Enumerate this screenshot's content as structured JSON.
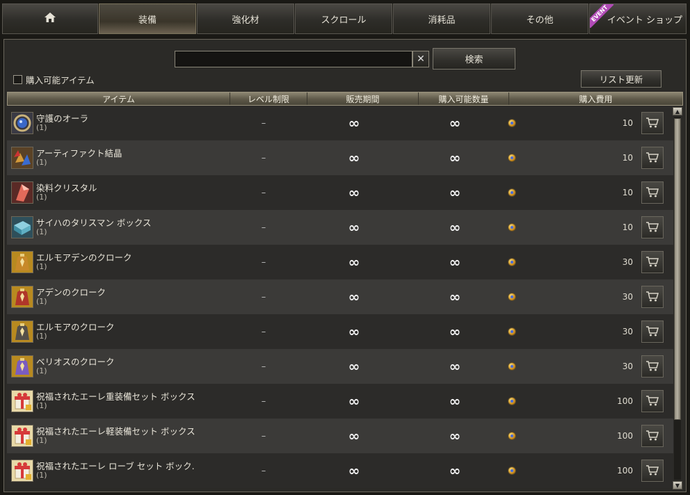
{
  "tabs": [
    {
      "label": "",
      "icon": "home-icon",
      "active": false
    },
    {
      "label": "装備",
      "active": true
    },
    {
      "label": "強化材",
      "active": false
    },
    {
      "label": "スクロール",
      "active": false
    },
    {
      "label": "消耗品",
      "active": false
    },
    {
      "label": "その他",
      "active": false
    },
    {
      "label": "イベント ショップ",
      "badge": "EVENT",
      "active": false
    }
  ],
  "search": {
    "value": "",
    "placeholder": "",
    "clear_label": "✕",
    "button_label": "検索"
  },
  "filter": {
    "buyable_label": "購入可能アイテム",
    "checked": false
  },
  "refresh_label": "リスト更新",
  "table": {
    "headers": [
      "アイテム",
      "レベル制限",
      "販売期間",
      "購入可能数量",
      "購入費用"
    ],
    "rows": [
      {
        "name": "守護のオーラ",
        "count": "(1)",
        "level": "–",
        "period": "∞",
        "qty": "∞",
        "price": "10",
        "icon": "aura-icon"
      },
      {
        "name": "アーティファクト結晶",
        "count": "(1)",
        "level": "–",
        "period": "∞",
        "qty": "∞",
        "price": "10",
        "icon": "crystal-icon"
      },
      {
        "name": "染料クリスタル",
        "count": "(1)",
        "level": "–",
        "period": "∞",
        "qty": "∞",
        "price": "10",
        "icon": "dye-crystal-icon"
      },
      {
        "name": "サイハのタリスマン ボックス",
        "count": "(1)",
        "level": "–",
        "period": "∞",
        "qty": "∞",
        "price": "10",
        "icon": "talisman-box-icon"
      },
      {
        "name": "エルモアデンのクローク",
        "count": "(1)",
        "level": "–",
        "period": "∞",
        "qty": "∞",
        "price": "30",
        "icon": "cloak-icon"
      },
      {
        "name": "アデンのクローク",
        "count": "(1)",
        "level": "–",
        "period": "∞",
        "qty": "∞",
        "price": "30",
        "icon": "cloak-icon"
      },
      {
        "name": "エルモアのクローク",
        "count": "(1)",
        "level": "–",
        "period": "∞",
        "qty": "∞",
        "price": "30",
        "icon": "cloak-icon"
      },
      {
        "name": "ベリオスのクローク",
        "count": "(1)",
        "level": "–",
        "period": "∞",
        "qty": "∞",
        "price": "30",
        "icon": "cloak-icon"
      },
      {
        "name": "祝福されたエーレ重装備セット ボックス",
        "count": "(1)",
        "level": "–",
        "period": "∞",
        "qty": "∞",
        "price": "100",
        "icon": "gift-box-icon"
      },
      {
        "name": "祝福されたエーレ軽装備セット ボックス",
        "count": "(1)",
        "level": "–",
        "period": "∞",
        "qty": "∞",
        "price": "100",
        "icon": "gift-box-icon"
      },
      {
        "name": "祝福されたエーレ ローブ セット ボック.",
        "count": "(1)",
        "level": "–",
        "period": "∞",
        "qty": "∞",
        "price": "100",
        "icon": "gift-box-icon"
      }
    ]
  },
  "colors": {
    "cloak_1": "#c7892a",
    "cloak_2": "#b0362a",
    "cloak_3": "#555049",
    "cloak_4": "#7a5cc0"
  }
}
